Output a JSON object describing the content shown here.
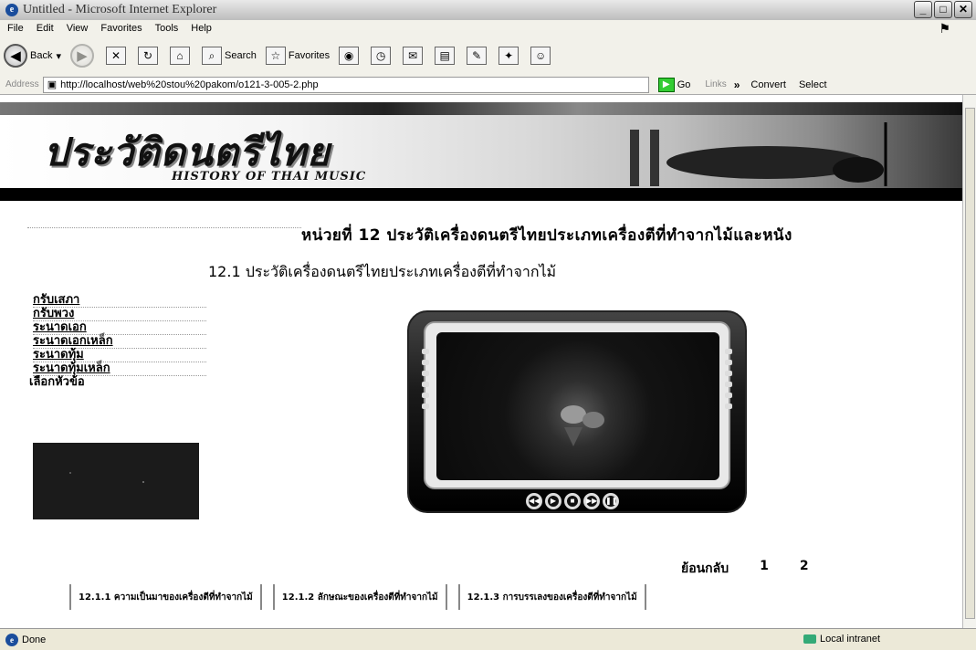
{
  "window": {
    "title": "Untitled - Microsoft Internet Explorer"
  },
  "menu": [
    "File",
    "Edit",
    "View",
    "Favorites",
    "Tools",
    "Help"
  ],
  "toolbar": {
    "back": "Back",
    "search": "Search",
    "favorites": "Favorites"
  },
  "address": {
    "label": "Address",
    "url": "http://localhost/web%20stou%20pakom/o121-3-005-2.php",
    "go": "Go",
    "links": "Links",
    "convert": "Convert",
    "select": "Select"
  },
  "page": {
    "banner_thai": "ประวัติดนตรีไทย",
    "banner_en": "HISTORY OF THAI MUSIC",
    "unit_title": "หน่วยที่ 12 ประวัติเครื่องดนตรีไทยประเภทเครื่องตีที่ทำจากไม้และหนัง",
    "section_title": "12.1 ประวัติเครื่องดนตรีไทยประเภทเครื่องตีที่ทำจากไม้",
    "side_menu": [
      "กรับเสภา",
      "กรับพวง",
      "ระนาดเอก",
      "ระนาดเอกเหล็ก",
      "ระนาดทุ้ม",
      "ระนาดทุ้มเหล็ก",
      "เลือกหัวข้อ"
    ],
    "nav": {
      "back_label": "ย้อนกลับ",
      "pages": [
        "1",
        "2"
      ]
    },
    "sub_tabs": [
      "12.1.1 ความเป็นมาของเครื่องตีที่ทำจากไม้",
      "12.1.2 ลักษณะของเครื่องตีที่ทำจากไม้",
      "12.1.3 การบรรเลงของเครื่องตีที่ทำจากไม้"
    ]
  },
  "status": {
    "left": "Done",
    "zone": "Local intranet"
  }
}
